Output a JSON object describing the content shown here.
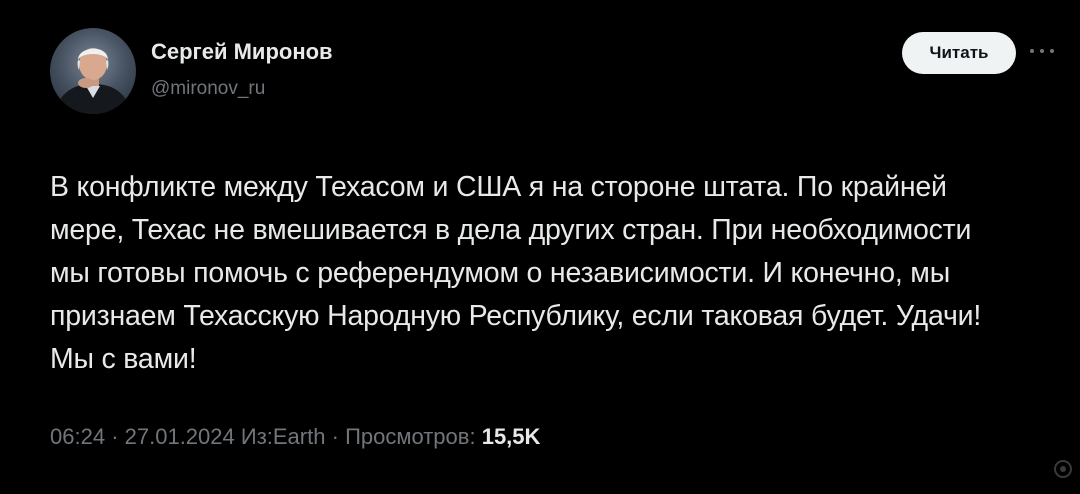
{
  "author": {
    "name": "Сергей Миронов",
    "handle": "@mironov_ru"
  },
  "follow_button_label": "Читать",
  "more_icon": "more-dots-icon",
  "tweet_text": "В конфликте между Техасом и США я на стороне штата. По крайней мере, Техас не вмешивается в дела других стран. При необходимости мы готовы помочь с референдумом о независимости. И конечно, мы признаем Техасскую Народную Республику, если таковая будет. Удачи! Мы с вами!",
  "meta": {
    "time": "06:24",
    "separator": "·",
    "date": "27.01.2024",
    "source": "Из:Earth",
    "views_label": "Просмотров:",
    "views_count": "15,5K"
  },
  "colors": {
    "background": "#000000",
    "primary_text": "#e7e9ea",
    "secondary_text": "#71767b",
    "button_bg": "#eff3f4",
    "button_text": "#0f1419"
  }
}
